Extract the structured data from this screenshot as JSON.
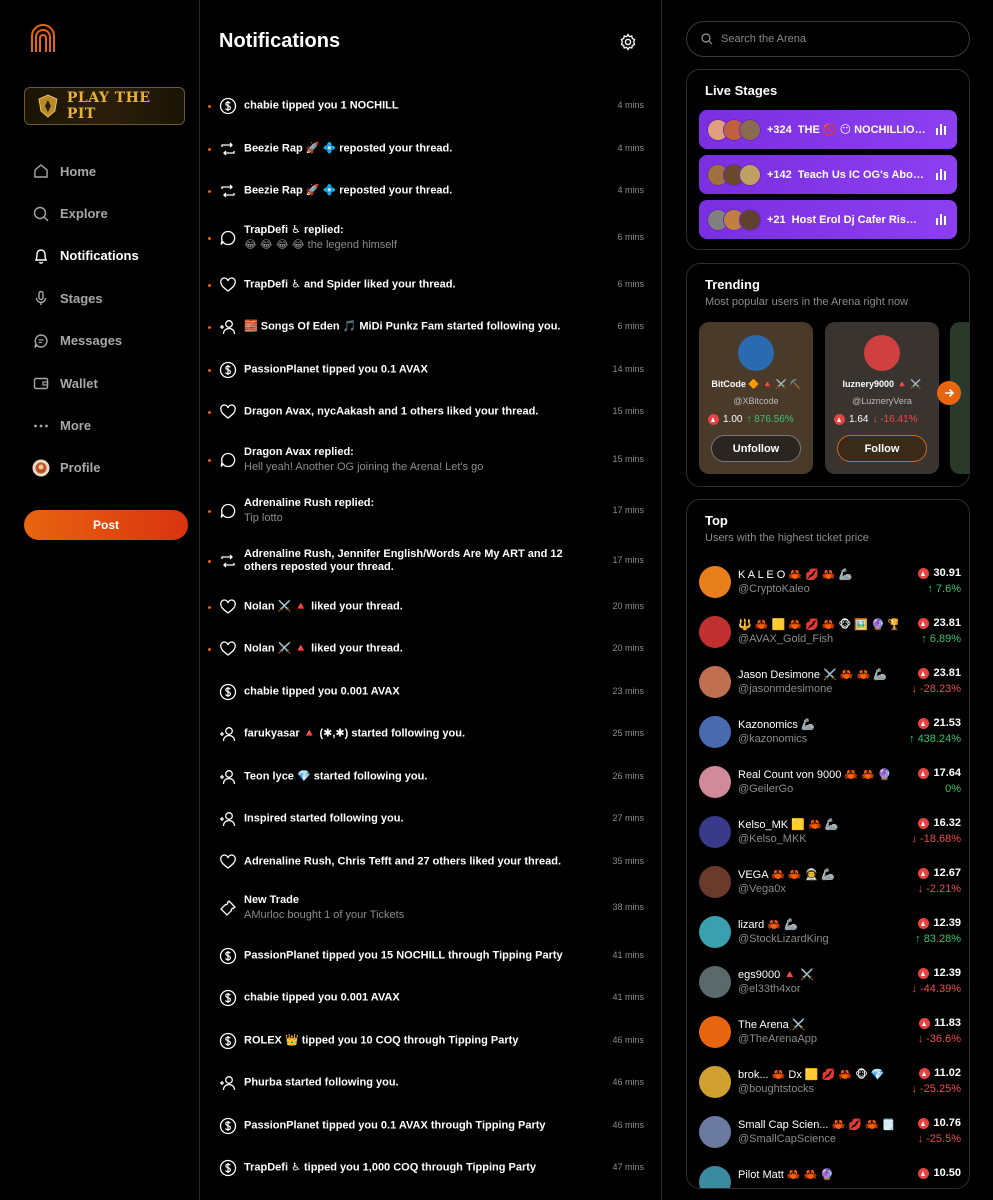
{
  "sidebar": {
    "banner_text": "PLAY THE PIT",
    "nav": [
      {
        "label": "Home",
        "icon": "home-icon"
      },
      {
        "label": "Explore",
        "icon": "search-icon"
      },
      {
        "label": "Notifications",
        "icon": "bell-icon",
        "active": true
      },
      {
        "label": "Stages",
        "icon": "microphone-icon"
      },
      {
        "label": "Messages",
        "icon": "chat-icon"
      },
      {
        "label": "Wallet",
        "icon": "wallet-icon"
      },
      {
        "label": "More",
        "icon": "more-icon"
      },
      {
        "label": "Profile",
        "icon": "avatar"
      }
    ],
    "post_label": "Post"
  },
  "center": {
    "title": "Notifications",
    "notifications": [
      {
        "icon": "dollar-icon",
        "text": "chabie tipped you 1 NOCHILL",
        "sub": "",
        "time": "4 mins",
        "unread": true
      },
      {
        "icon": "repost-icon",
        "text": "Beezie Rap 🚀 💠 reposted your thread.",
        "sub": "",
        "time": "4 mins",
        "unread": true
      },
      {
        "icon": "repost-icon",
        "text": "Beezie Rap 🚀 💠 reposted your thread.",
        "sub": "",
        "time": "4 mins",
        "unread": true
      },
      {
        "icon": "reply-icon",
        "text": "TrapDefi ♿ replied:",
        "sub": "😂 😂 😂 😂 the legend himself",
        "time": "6 mins",
        "unread": true
      },
      {
        "icon": "heart-icon",
        "text": "TrapDefi ♿ and Spider liked your thread.",
        "sub": "",
        "time": "6 mins",
        "unread": true
      },
      {
        "icon": "follow-icon",
        "text": "🧱 Songs Of Eden 🎵 MiDi Punkz Fam started following you.",
        "sub": "",
        "time": "6 mins",
        "unread": true
      },
      {
        "icon": "dollar-icon",
        "text": "PassionPlanet tipped you 0.1 AVAX",
        "sub": "",
        "time": "14 mins",
        "unread": true
      },
      {
        "icon": "heart-icon",
        "text": "Dragon Avax, nycAakash and 1 others liked your thread.",
        "sub": "",
        "time": "15 mins",
        "unread": true
      },
      {
        "icon": "reply-icon",
        "text": "Dragon Avax replied:",
        "sub": "Hell yeah! Another OG joining the Arena! Let's go",
        "time": "15 mins",
        "unread": true
      },
      {
        "icon": "reply-icon",
        "text": "Adrenaline Rush replied:",
        "sub": "Tip lotto",
        "time": "17 mins",
        "unread": true
      },
      {
        "icon": "repost-icon",
        "text": "Adrenaline Rush, Jennifer English/Words Are My ART and 12 others reposted your thread.",
        "sub": "",
        "time": "17 mins",
        "unread": true
      },
      {
        "icon": "heart-icon",
        "text": "Nolan ⚔️ 🔺 liked your thread.",
        "sub": "",
        "time": "20 mins",
        "unread": true
      },
      {
        "icon": "heart-icon",
        "text": "Nolan ⚔️ 🔺 liked your thread.",
        "sub": "",
        "time": "20 mins",
        "unread": true
      },
      {
        "icon": "dollar-icon",
        "text": "chabie tipped you 0.001 AVAX",
        "sub": "",
        "time": "23 mins",
        "unread": false
      },
      {
        "icon": "follow-icon",
        "text": "farukyasar 🔺 (✱,✱) started following you.",
        "sub": "",
        "time": "25 mins",
        "unread": false
      },
      {
        "icon": "follow-icon",
        "text": "Teon lyce 💎 started following you.",
        "sub": "",
        "time": "26 mins",
        "unread": false
      },
      {
        "icon": "follow-icon",
        "text": "Inspired started following you.",
        "sub": "",
        "time": "27 mins",
        "unread": false
      },
      {
        "icon": "heart-icon",
        "text": "Adrenaline Rush, Chris Tefft and 27 others liked your thread.",
        "sub": "",
        "time": "35 mins",
        "unread": false
      },
      {
        "icon": "ticket-icon",
        "text": "New Trade",
        "sub": "AMurloc bought 1 of your Tickets",
        "time": "38 mins",
        "unread": false
      },
      {
        "icon": "dollar-icon",
        "text": "PassionPlanet tipped you 15 NOCHILL through Tipping Party",
        "sub": "",
        "time": "41 mins",
        "unread": false
      },
      {
        "icon": "dollar-icon",
        "text": "chabie tipped you 0.001 AVAX",
        "sub": "",
        "time": "41 mins",
        "unread": false
      },
      {
        "icon": "dollar-icon",
        "text": "ROLEX 👑 tipped you 10 COQ through Tipping Party",
        "sub": "",
        "time": "46 mins",
        "unread": false
      },
      {
        "icon": "follow-icon",
        "text": "Phurba started following you.",
        "sub": "",
        "time": "46 mins",
        "unread": false
      },
      {
        "icon": "dollar-icon",
        "text": "PassionPlanet tipped you 0.1 AVAX through Tipping Party",
        "sub": "",
        "time": "46 mins",
        "unread": false
      },
      {
        "icon": "dollar-icon",
        "text": "TrapDefi ♿ tipped you 1,000 COQ through Tipping Party",
        "sub": "",
        "time": "47 mins",
        "unread": false
      }
    ]
  },
  "right": {
    "search_placeholder": "Search the Arena",
    "live_stages": {
      "title": "Live Stages",
      "items": [
        {
          "count": "+324",
          "title": "THE 🚫 😶 NOCHILLIO ..."
        },
        {
          "count": "+142",
          "title": "Teach Us IC OG's Abou..."
        },
        {
          "count": "+21",
          "title": "Host Erol Dj Cafer Rise U..."
        }
      ]
    },
    "trending": {
      "title": "Trending",
      "subtitle": "Most popular users in the Arena right now",
      "cards": [
        {
          "name": "BitCode 🔶 🔺 ⚔️ ⛏️",
          "handle": "@XBitcode",
          "price": "1.00",
          "change": "876.56%",
          "dir": "up",
          "button": "Unfollow"
        },
        {
          "name": "luznery9000 🔺 ⚔️",
          "handle": "@LuzneryVera",
          "price": "1.64",
          "change": "-16.41%",
          "dir": "down",
          "button": "Follow"
        }
      ]
    },
    "top": {
      "title": "Top",
      "subtitle": "Users with the highest ticket price",
      "rows": [
        {
          "name": "K A L E O 🦀 💋 🦀 🦾",
          "handle": "@CryptoKaleo",
          "price": "30.91",
          "change": "7.6%",
          "dir": "up",
          "color": "#e87f1a"
        },
        {
          "name": "🔱 🦀 🟨 🦀 💋 🦀 🐵 🖼️ 🔮 🏆 👁️",
          "handle": "@AVAX_Gold_Fish",
          "price": "23.81",
          "change": "6.89%",
          "dir": "up",
          "color": "#c03030"
        },
        {
          "name": "Jason Desimone ⚔️ 🦀 🦀 🦾",
          "handle": "@jasonmdesimone",
          "price": "23.81",
          "change": "-28.23%",
          "dir": "down",
          "color": "#c07050"
        },
        {
          "name": "Kazonomics 🦾",
          "handle": "@kazonomics",
          "price": "21.53",
          "change": "438.24%",
          "dir": "up",
          "color": "#4a6ab0"
        },
        {
          "name": "Real Count von 9000 🦀 🦀 🔮",
          "handle": "@GeilerGo",
          "price": "17.64",
          "change": "0%",
          "dir": "neutral",
          "color": "#d08a9a"
        },
        {
          "name": "Kelso_MK 🟨 🦀 🦾",
          "handle": "@Kelso_MKK",
          "price": "16.32",
          "change": "-18.68%",
          "dir": "down",
          "color": "#3a3a8a"
        },
        {
          "name": "VEGA 🦀 🦀 👨‍🚀 🦾",
          "handle": "@Vega0x",
          "price": "12.67",
          "change": "-2.21%",
          "dir": "down",
          "color": "#6a3a2a"
        },
        {
          "name": "lizard 🦀 🦾",
          "handle": "@StockLizardKing",
          "price": "12.39",
          "change": "83.28%",
          "dir": "up",
          "color": "#3aa0b0"
        },
        {
          "name": "egs9000 🔺 ⚔️",
          "handle": "@el33th4xor",
          "price": "12.39",
          "change": "-44.39%",
          "dir": "down",
          "color": "#5a6a6a"
        },
        {
          "name": "The Arena ⚔️",
          "handle": "@TheArenaApp",
          "price": "11.83",
          "change": "-36.6%",
          "dir": "down",
          "color": "#e8650f"
        },
        {
          "name": "brok... 🦀 Dx 🟨 💋 🦀 🐵 💎",
          "handle": "@boughtstocks",
          "price": "11.02",
          "change": "-25.25%",
          "dir": "down",
          "color": "#d0a030"
        },
        {
          "name": "Small Cap Scien... 🦀 💋 🦀 🗒️",
          "handle": "@SmallCapScience",
          "price": "10.76",
          "change": "-25.5%",
          "dir": "down",
          "color": "#6a7aa0"
        },
        {
          "name": "Pilot Matt 🦀 🦀 🔮",
          "handle": "",
          "price": "10.50",
          "change": "",
          "dir": "up",
          "color": "#3a8aa0"
        }
      ]
    }
  }
}
